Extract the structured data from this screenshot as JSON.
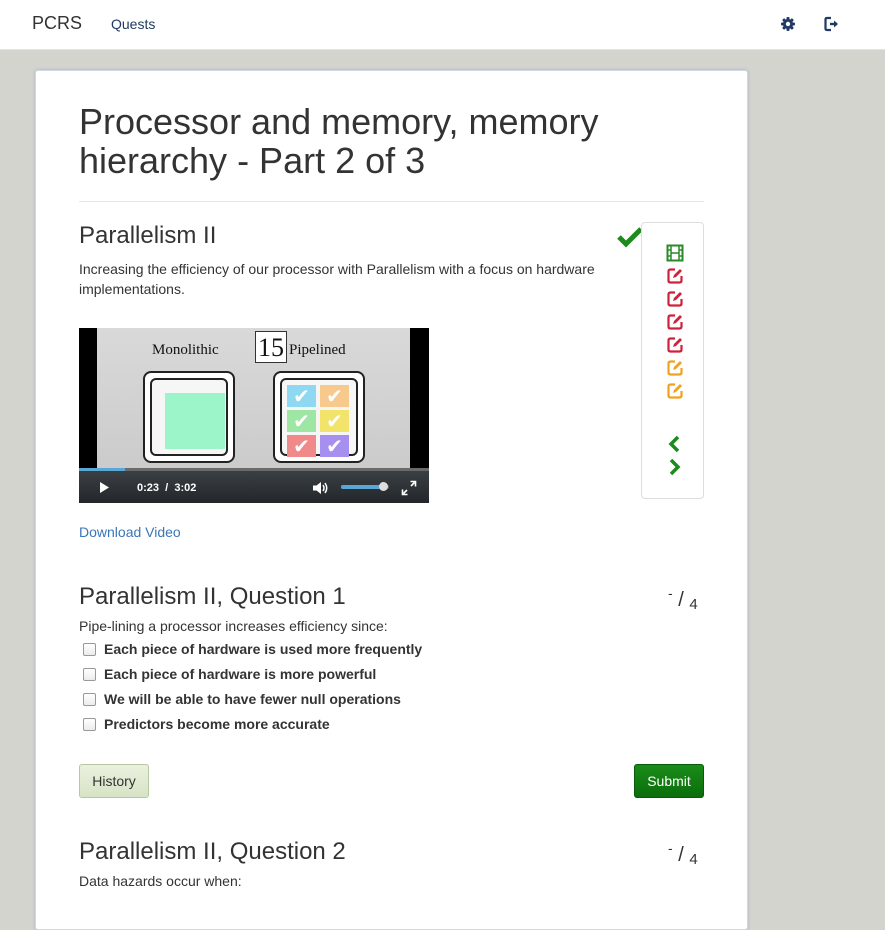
{
  "nav": {
    "brand": "PCRS",
    "quests": "Quests",
    "settings_icon": "gear-icon",
    "logout_icon": "sign-out-icon"
  },
  "page": {
    "title": "Processor and memory, memory hierarchy - Part 2 of 3"
  },
  "section": {
    "title": "Parallelism II",
    "description": "Increasing the efficiency of our processor with Parallelism with a focus on hardware implementations.",
    "completed_icon": "checkmark-icon",
    "download_label": "Download Video"
  },
  "video": {
    "slide_number": "15",
    "left_label": "Monolithic",
    "right_label": "Pipelined",
    "current_time": "0:23",
    "separator": "/",
    "duration": "3:02",
    "progress_fraction": 0.13,
    "volume_fraction": 0.9
  },
  "side_panel": {
    "items": [
      {
        "icon": "film-icon",
        "color": "#2a8a2a"
      },
      {
        "icon": "edit-icon",
        "color": "#d0213a"
      },
      {
        "icon": "edit-icon",
        "color": "#d0213a"
      },
      {
        "icon": "edit-icon",
        "color": "#d0213a"
      },
      {
        "icon": "edit-icon",
        "color": "#d0213a"
      },
      {
        "icon": "edit-icon",
        "color": "#f0a21e"
      },
      {
        "icon": "edit-icon",
        "color": "#f0a21e"
      }
    ],
    "prev_icon": "chevron-left-icon",
    "next_icon": "chevron-right-icon",
    "nav_color": "#1c8a1c"
  },
  "questions": [
    {
      "title": "Parallelism II, Question 1",
      "score": "-",
      "max": "4",
      "prompt": "Pipe-lining a processor increases efficiency since:",
      "options": [
        "Each piece of hardware is used more frequently",
        "Each piece of hardware is more powerful",
        "We will be able to have fewer null operations",
        "Predictors become more accurate"
      ],
      "history_label": "History",
      "submit_label": "Submit"
    },
    {
      "title": "Parallelism II, Question 2",
      "score": "-",
      "max": "4",
      "prompt": "Data hazards occur when:"
    }
  ],
  "colors": {
    "background": "#d4d4cf",
    "link": "#3a76b8",
    "submit": "#0b7a0b",
    "complete": "#1c8a1c"
  }
}
